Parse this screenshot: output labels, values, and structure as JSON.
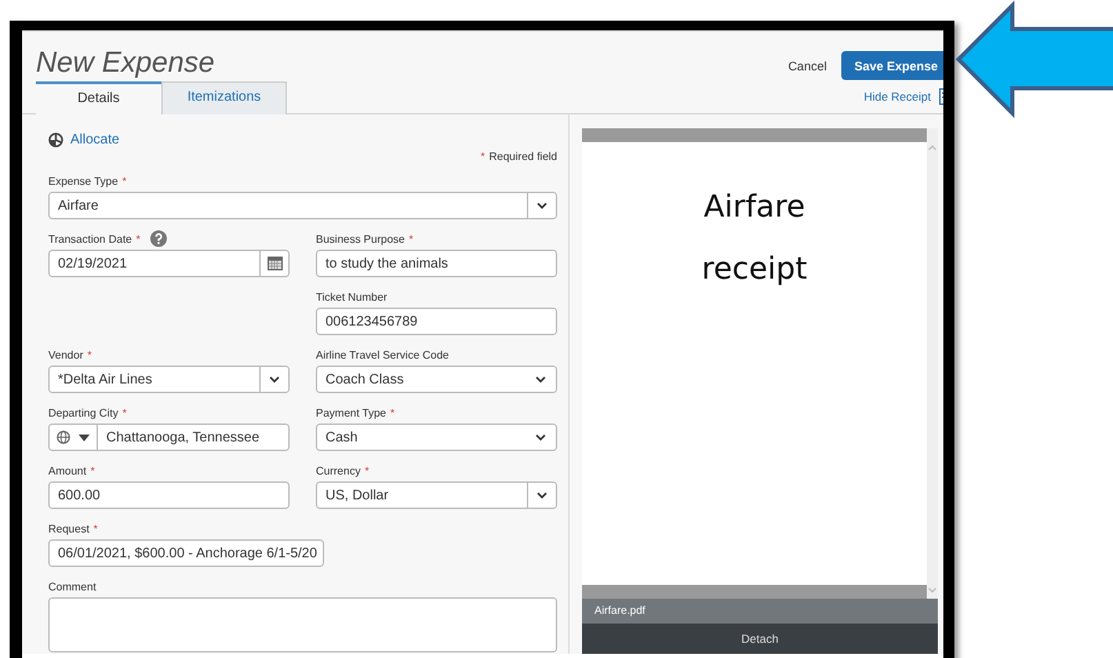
{
  "header": {
    "title": "New Expense",
    "cancel": "Cancel",
    "save": "Save Expense",
    "hide_receipt": "Hide Receipt"
  },
  "tabs": [
    {
      "label": "Details",
      "selected": true
    },
    {
      "label": "Itemizations",
      "selected": false
    }
  ],
  "allocate": "Allocate",
  "required_note": {
    "mark": "*",
    "text": "Required field"
  },
  "rows": [
    {
      "full": {
        "label": "Expense Type",
        "mark": "*",
        "value": "Airfare",
        "kind": "select"
      }
    },
    {
      "left": {
        "label": "Transaction Date",
        "mark": "*",
        "help": true,
        "value": "02/19/2021",
        "kind": "date"
      },
      "right": {
        "label": "Business Purpose",
        "mark": "*",
        "value": "to study the animals",
        "kind": "text"
      }
    },
    {
      "right": {
        "label": "Ticket Number",
        "value": "006123456789",
        "kind": "text"
      }
    },
    {
      "left": {
        "label": "Vendor",
        "mark": "*",
        "value": "*Delta Air Lines",
        "kind": "select"
      },
      "right": {
        "label": "Airline Travel Service Code",
        "value": "Coach Class",
        "kind": "dropdown"
      }
    },
    {
      "left": {
        "label": "Departing City",
        "mark": "*",
        "value": "Chattanooga, Tennessee",
        "kind": "location"
      },
      "right": {
        "label": "Payment Type",
        "mark": "*",
        "value": "Cash",
        "kind": "dropdown"
      }
    },
    {
      "left": {
        "label": "Amount",
        "mark": "*",
        "value": "600.00",
        "kind": "text"
      },
      "right": {
        "label": "Currency",
        "mark": "*",
        "value": "US, Dollar",
        "kind": "select"
      }
    },
    {
      "left": {
        "label": "Request",
        "mark": "*",
        "value": "06/01/2021, $600.00 - Anchorage 6/1-5/20",
        "kind": "wide"
      }
    },
    {
      "full": {
        "label": "Comment",
        "kind": "textarea"
      }
    }
  ],
  "receipt": {
    "content": "Airfare receipt",
    "file_name": "Airfare.pdf",
    "detach": "Detach"
  }
}
